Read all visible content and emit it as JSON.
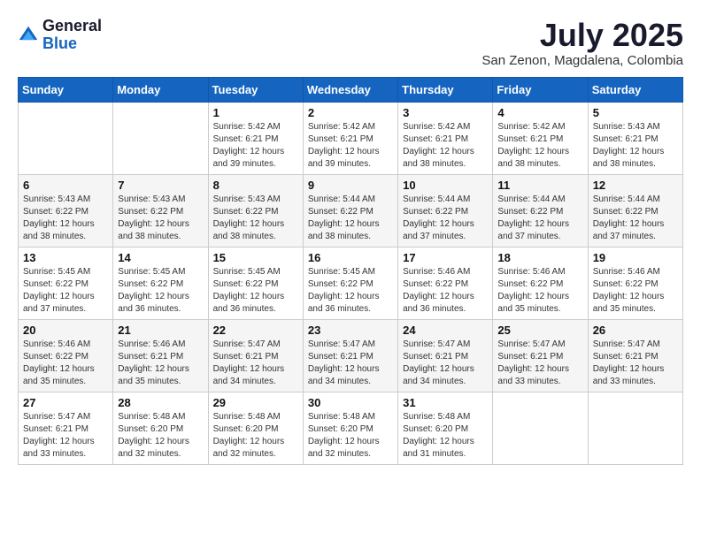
{
  "header": {
    "logo_general": "General",
    "logo_blue": "Blue",
    "month": "July 2025",
    "location": "San Zenon, Magdalena, Colombia"
  },
  "days_of_week": [
    "Sunday",
    "Monday",
    "Tuesday",
    "Wednesday",
    "Thursday",
    "Friday",
    "Saturday"
  ],
  "weeks": [
    [
      {
        "day": "",
        "sunrise": "",
        "sunset": "",
        "daylight": ""
      },
      {
        "day": "",
        "sunrise": "",
        "sunset": "",
        "daylight": ""
      },
      {
        "day": "1",
        "sunrise": "Sunrise: 5:42 AM",
        "sunset": "Sunset: 6:21 PM",
        "daylight": "Daylight: 12 hours and 39 minutes."
      },
      {
        "day": "2",
        "sunrise": "Sunrise: 5:42 AM",
        "sunset": "Sunset: 6:21 PM",
        "daylight": "Daylight: 12 hours and 39 minutes."
      },
      {
        "day": "3",
        "sunrise": "Sunrise: 5:42 AM",
        "sunset": "Sunset: 6:21 PM",
        "daylight": "Daylight: 12 hours and 38 minutes."
      },
      {
        "day": "4",
        "sunrise": "Sunrise: 5:42 AM",
        "sunset": "Sunset: 6:21 PM",
        "daylight": "Daylight: 12 hours and 38 minutes."
      },
      {
        "day": "5",
        "sunrise": "Sunrise: 5:43 AM",
        "sunset": "Sunset: 6:21 PM",
        "daylight": "Daylight: 12 hours and 38 minutes."
      }
    ],
    [
      {
        "day": "6",
        "sunrise": "Sunrise: 5:43 AM",
        "sunset": "Sunset: 6:22 PM",
        "daylight": "Daylight: 12 hours and 38 minutes."
      },
      {
        "day": "7",
        "sunrise": "Sunrise: 5:43 AM",
        "sunset": "Sunset: 6:22 PM",
        "daylight": "Daylight: 12 hours and 38 minutes."
      },
      {
        "day": "8",
        "sunrise": "Sunrise: 5:43 AM",
        "sunset": "Sunset: 6:22 PM",
        "daylight": "Daylight: 12 hours and 38 minutes."
      },
      {
        "day": "9",
        "sunrise": "Sunrise: 5:44 AM",
        "sunset": "Sunset: 6:22 PM",
        "daylight": "Daylight: 12 hours and 38 minutes."
      },
      {
        "day": "10",
        "sunrise": "Sunrise: 5:44 AM",
        "sunset": "Sunset: 6:22 PM",
        "daylight": "Daylight: 12 hours and 37 minutes."
      },
      {
        "day": "11",
        "sunrise": "Sunrise: 5:44 AM",
        "sunset": "Sunset: 6:22 PM",
        "daylight": "Daylight: 12 hours and 37 minutes."
      },
      {
        "day": "12",
        "sunrise": "Sunrise: 5:44 AM",
        "sunset": "Sunset: 6:22 PM",
        "daylight": "Daylight: 12 hours and 37 minutes."
      }
    ],
    [
      {
        "day": "13",
        "sunrise": "Sunrise: 5:45 AM",
        "sunset": "Sunset: 6:22 PM",
        "daylight": "Daylight: 12 hours and 37 minutes."
      },
      {
        "day": "14",
        "sunrise": "Sunrise: 5:45 AM",
        "sunset": "Sunset: 6:22 PM",
        "daylight": "Daylight: 12 hours and 36 minutes."
      },
      {
        "day": "15",
        "sunrise": "Sunrise: 5:45 AM",
        "sunset": "Sunset: 6:22 PM",
        "daylight": "Daylight: 12 hours and 36 minutes."
      },
      {
        "day": "16",
        "sunrise": "Sunrise: 5:45 AM",
        "sunset": "Sunset: 6:22 PM",
        "daylight": "Daylight: 12 hours and 36 minutes."
      },
      {
        "day": "17",
        "sunrise": "Sunrise: 5:46 AM",
        "sunset": "Sunset: 6:22 PM",
        "daylight": "Daylight: 12 hours and 36 minutes."
      },
      {
        "day": "18",
        "sunrise": "Sunrise: 5:46 AM",
        "sunset": "Sunset: 6:22 PM",
        "daylight": "Daylight: 12 hours and 35 minutes."
      },
      {
        "day": "19",
        "sunrise": "Sunrise: 5:46 AM",
        "sunset": "Sunset: 6:22 PM",
        "daylight": "Daylight: 12 hours and 35 minutes."
      }
    ],
    [
      {
        "day": "20",
        "sunrise": "Sunrise: 5:46 AM",
        "sunset": "Sunset: 6:22 PM",
        "daylight": "Daylight: 12 hours and 35 minutes."
      },
      {
        "day": "21",
        "sunrise": "Sunrise: 5:46 AM",
        "sunset": "Sunset: 6:21 PM",
        "daylight": "Daylight: 12 hours and 35 minutes."
      },
      {
        "day": "22",
        "sunrise": "Sunrise: 5:47 AM",
        "sunset": "Sunset: 6:21 PM",
        "daylight": "Daylight: 12 hours and 34 minutes."
      },
      {
        "day": "23",
        "sunrise": "Sunrise: 5:47 AM",
        "sunset": "Sunset: 6:21 PM",
        "daylight": "Daylight: 12 hours and 34 minutes."
      },
      {
        "day": "24",
        "sunrise": "Sunrise: 5:47 AM",
        "sunset": "Sunset: 6:21 PM",
        "daylight": "Daylight: 12 hours and 34 minutes."
      },
      {
        "day": "25",
        "sunrise": "Sunrise: 5:47 AM",
        "sunset": "Sunset: 6:21 PM",
        "daylight": "Daylight: 12 hours and 33 minutes."
      },
      {
        "day": "26",
        "sunrise": "Sunrise: 5:47 AM",
        "sunset": "Sunset: 6:21 PM",
        "daylight": "Daylight: 12 hours and 33 minutes."
      }
    ],
    [
      {
        "day": "27",
        "sunrise": "Sunrise: 5:47 AM",
        "sunset": "Sunset: 6:21 PM",
        "daylight": "Daylight: 12 hours and 33 minutes."
      },
      {
        "day": "28",
        "sunrise": "Sunrise: 5:48 AM",
        "sunset": "Sunset: 6:20 PM",
        "daylight": "Daylight: 12 hours and 32 minutes."
      },
      {
        "day": "29",
        "sunrise": "Sunrise: 5:48 AM",
        "sunset": "Sunset: 6:20 PM",
        "daylight": "Daylight: 12 hours and 32 minutes."
      },
      {
        "day": "30",
        "sunrise": "Sunrise: 5:48 AM",
        "sunset": "Sunset: 6:20 PM",
        "daylight": "Daylight: 12 hours and 32 minutes."
      },
      {
        "day": "31",
        "sunrise": "Sunrise: 5:48 AM",
        "sunset": "Sunset: 6:20 PM",
        "daylight": "Daylight: 12 hours and 31 minutes."
      },
      {
        "day": "",
        "sunrise": "",
        "sunset": "",
        "daylight": ""
      },
      {
        "day": "",
        "sunrise": "",
        "sunset": "",
        "daylight": ""
      }
    ]
  ]
}
